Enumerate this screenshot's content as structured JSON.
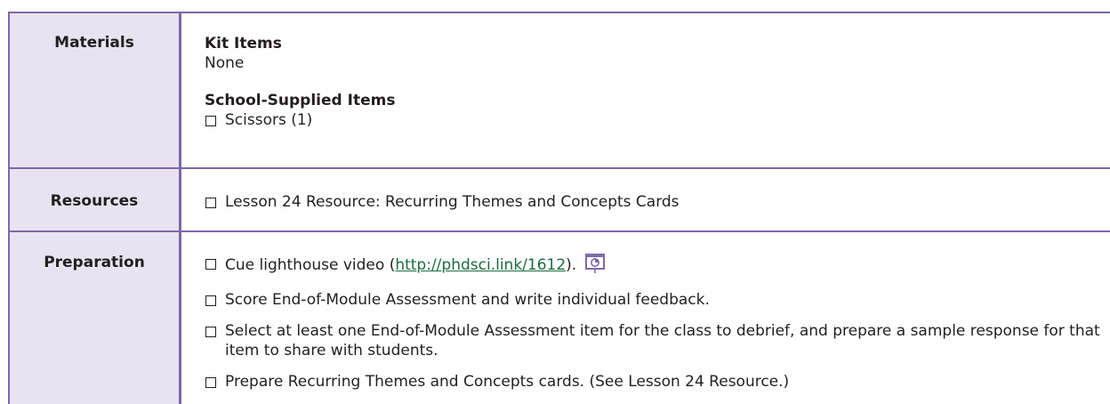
{
  "materials": {
    "label": "Materials",
    "kit_heading": "Kit Items",
    "kit_value": "None",
    "school_heading": "School-Supplied Items",
    "school_items": [
      "Scissors (1)"
    ]
  },
  "resources": {
    "label": "Resources",
    "items": [
      "Lesson 24 Resource: Recurring Themes and Concepts Cards"
    ]
  },
  "preparation": {
    "label": "Preparation",
    "item1_prefix": "Cue lighthouse video (",
    "item1_link": "http://phdsci.link/1612",
    "item1_suffix": ").",
    "item1_icon": "slide-presentation-icon",
    "items": [
      "Score End-of-Module Assessment and write individual feedback.",
      "Select at least one End-of-Module Assessment item for the class to debrief, and prepare a sample response for that item to share with students.",
      "Prepare Recurring Themes and Concepts cards. (See Lesson 24 Resource.)"
    ]
  },
  "colors": {
    "border": "#7f68a8",
    "label_bg": "#e9e3f1",
    "link": "#1b6b3f",
    "text": "#231f20"
  }
}
